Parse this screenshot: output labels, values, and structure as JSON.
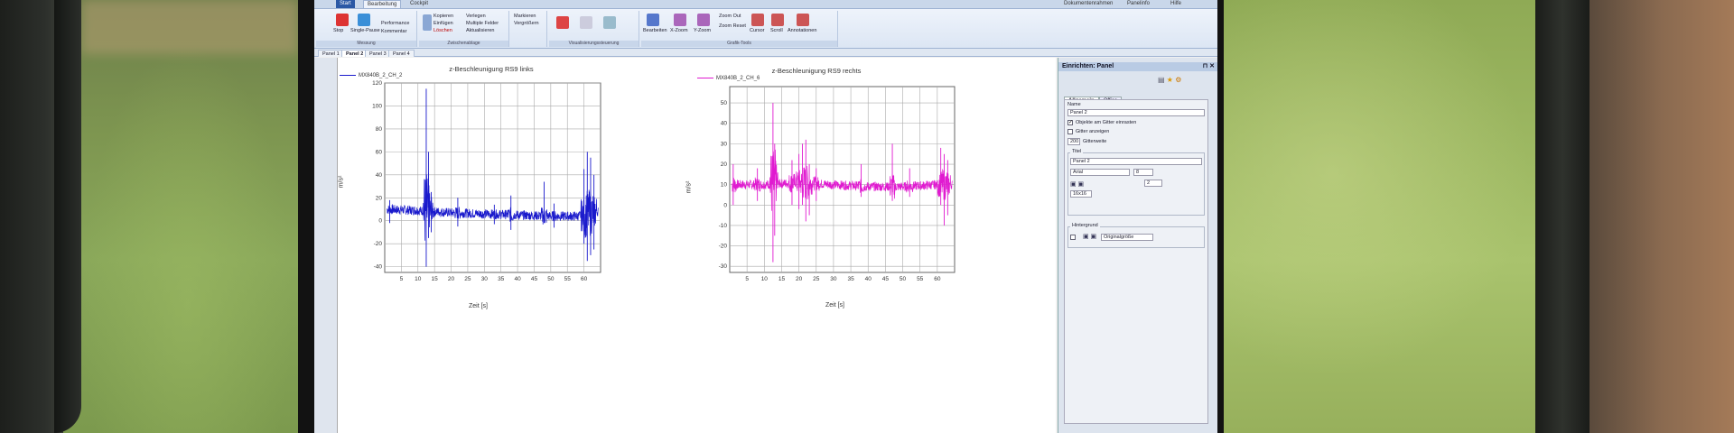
{
  "ribbon": {
    "tabs": [
      "Start",
      "Bearbeitung",
      "Cockpit"
    ],
    "top_right": [
      "Dokumentenrahmen",
      "Panelinfo",
      "Hilfe"
    ],
    "buttons": {
      "stop": "Stop",
      "single_pause": "Single-Pause",
      "performance": "Performance",
      "kommentar": "Kommentar",
      "copy": "Kopieren",
      "paste": "Einfügen",
      "delete": "Löschen",
      "arrange": "Verlegen",
      "multiple_fields": "Multiple Felder",
      "update": "Aktualisieren",
      "enlarge": "Vergrößern",
      "measure": "Markieren",
      "cursor_mode": "Bearbeiten",
      "x_zoom": "X-Zoom",
      "y_zoom": "Y-Zoom",
      "zoom_out": "Zoom Out",
      "zoom_reset": "Zoom Reset",
      "cursor": "Cursor",
      "scroll": "Scroll",
      "annotations": "Annotationen"
    },
    "groups": [
      "Messung",
      "Zwischenablage",
      "Visualisierungssteuerung",
      "Grafik-Tools"
    ]
  },
  "panel_tabs": [
    "Panel 1",
    "Panel 2",
    "Panel 3",
    "Panel 4"
  ],
  "active_panel_tab": "Panel 2",
  "side_panel": {
    "title": "Einrichten: Panel",
    "tabs": [
      "Allgemein",
      "Office"
    ],
    "name_label": "Name",
    "name_value": "Panel 2",
    "chk_objects_label": "Objekte am Gitter einrasten",
    "chk_grid_label": "Gitter anzeigen",
    "grid_width_value": "200",
    "grid_width_label": "Gitterweite",
    "title_group_label": "Titel",
    "title_value": "Panel 2",
    "font_value": "Arial",
    "font_size_value": "8",
    "line_value": "2",
    "size_value": "16x16",
    "background_group_label": "Hintergrund",
    "background_value": "Originalgröße"
  },
  "chart_data": [
    {
      "type": "line",
      "title": "z-Beschleunigung RS9 links",
      "xlabel": "Zeit [s]",
      "ylabel": "m/s²",
      "xlim": [
        0,
        65
      ],
      "ylim": [
        -45,
        120
      ],
      "xticks": [
        5,
        10,
        15,
        20,
        25,
        30,
        35,
        40,
        45,
        50,
        55,
        60
      ],
      "yticks": [
        -40,
        -20,
        0,
        20,
        40,
        60,
        80,
        100,
        120
      ],
      "grid": true,
      "legend": "top-left",
      "series": [
        {
          "name": "MX840B_2_CH_2",
          "color": "#1a1acc",
          "baseline": [
            [
              0,
              10
            ],
            [
              10,
              9
            ],
            [
              20,
              7
            ],
            [
              30,
              6
            ],
            [
              40,
              5
            ],
            [
              50,
              4
            ],
            [
              58,
              4
            ],
            [
              61,
              6
            ],
            [
              64,
              8
            ]
          ],
          "spikes": [
            [
              1.5,
              18,
              -2
            ],
            [
              12.5,
              115,
              -40
            ],
            [
              13.2,
              60,
              -15
            ],
            [
              14,
              25,
              -10
            ],
            [
              22,
              20,
              -5
            ],
            [
              33,
              14,
              -3
            ],
            [
              38,
              22,
              -8
            ],
            [
              48,
              34,
              -2
            ],
            [
              51,
              15,
              -6
            ],
            [
              60,
              45,
              -20
            ],
            [
              61,
              60,
              -35
            ],
            [
              62,
              55,
              -30
            ],
            [
              63,
              40,
              -25
            ]
          ]
        }
      ]
    },
    {
      "type": "line",
      "title": "z-Beschleunigung RS9 rechts",
      "xlabel": "Zeit [s]",
      "ylabel": "m/s²",
      "xlim": [
        0,
        65
      ],
      "ylim": [
        -33,
        58
      ],
      "xticks": [
        5,
        10,
        15,
        20,
        25,
        30,
        35,
        40,
        45,
        50,
        55,
        60
      ],
      "yticks": [
        -30,
        -20,
        -10,
        0,
        10,
        20,
        30,
        40,
        50
      ],
      "grid": true,
      "legend": "top-left",
      "series": [
        {
          "name": "MX840B_2_CH_6",
          "color": "#e01ad0",
          "baseline": [
            [
              0,
              10
            ],
            [
              10,
              10
            ],
            [
              20,
              11
            ],
            [
              30,
              10
            ],
            [
              40,
              9
            ],
            [
              50,
              9
            ],
            [
              60,
              10
            ],
            [
              64,
              10
            ]
          ],
          "spikes": [
            [
              1,
              20,
              0
            ],
            [
              8,
              18,
              2
            ],
            [
              12.5,
              50,
              -28
            ],
            [
              13,
              30,
              -15
            ],
            [
              18,
              22,
              0
            ],
            [
              20,
              25,
              -2
            ],
            [
              21,
              30,
              0
            ],
            [
              22,
              32,
              -8
            ],
            [
              23,
              20,
              -5
            ],
            [
              25,
              18,
              2
            ],
            [
              38,
              20,
              4
            ],
            [
              47,
              30,
              2
            ],
            [
              52,
              18,
              4
            ],
            [
              61,
              28,
              0
            ],
            [
              62,
              25,
              -10
            ],
            [
              63,
              22,
              -5
            ]
          ]
        }
      ]
    }
  ]
}
